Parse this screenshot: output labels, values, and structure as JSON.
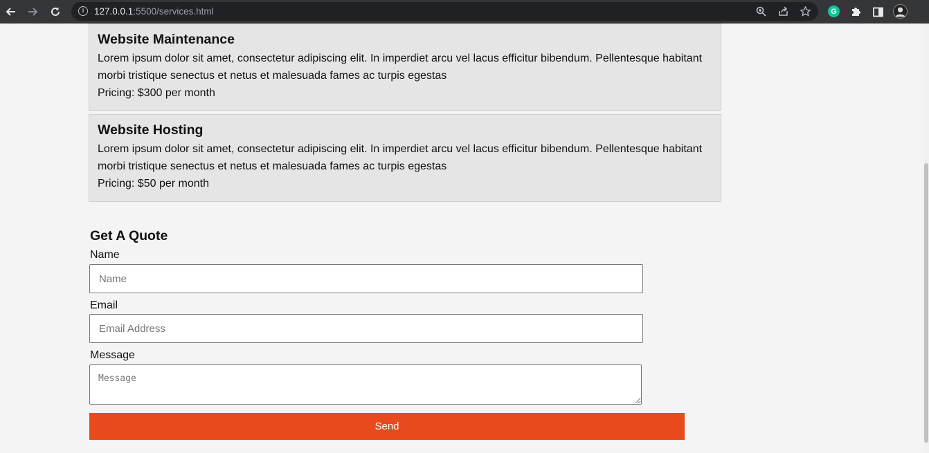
{
  "browser": {
    "url_host": "127.0.0.1",
    "url_path": ":5500/services.html",
    "icons": [
      "back-arrow-icon",
      "forward-arrow-icon",
      "reload-icon",
      "info-icon",
      "zoom-icon",
      "share-icon",
      "star-icon",
      "grammarly-icon",
      "puzzle-icon",
      "side-panel-icon",
      "avatar"
    ]
  },
  "services": [
    {
      "title": "Website Maintenance",
      "description": "Lorem ipsum dolor sit amet, consectetur adipiscing elit. In imperdiet arcu vel lacus efficitur bibendum. Pellentesque habitant morbi tristique senectus et netus et malesuada fames ac turpis egestas",
      "pricing": "Pricing: $300 per month"
    },
    {
      "title": "Website Hosting",
      "description": "Lorem ipsum dolor sit amet, consectetur adipiscing elit. In imperdiet arcu vel lacus efficitur bibendum. Pellentesque habitant morbi tristique senectus et netus et malesuada fames ac turpis egestas",
      "pricing": "Pricing: $50 per month"
    }
  ],
  "quote": {
    "title": "Get A Quote",
    "name_label": "Name",
    "name_placeholder": "Name",
    "email_label": "Email",
    "email_placeholder": "Email Address",
    "message_label": "Message",
    "message_placeholder": "Message",
    "send_label": "Send"
  },
  "colors": {
    "accent": "#e8491d",
    "card_bg": "#e5e5e5",
    "page_bg": "#f4f4f4"
  }
}
